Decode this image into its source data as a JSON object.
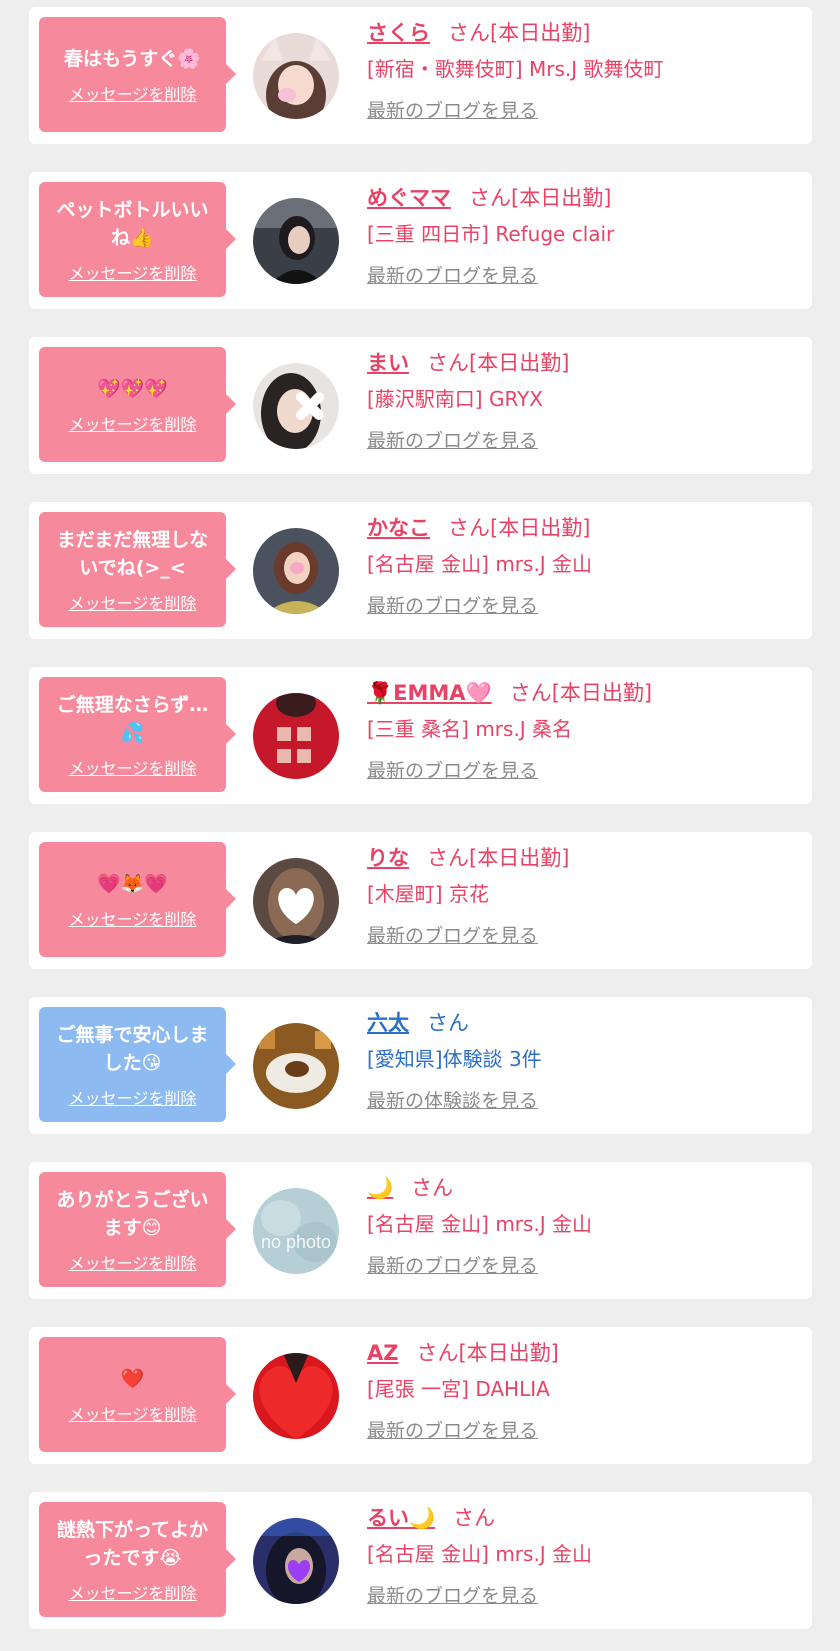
{
  "items": [
    {
      "message": "春はもうすぐ🌸",
      "delete_label": "メッセージを削除",
      "name": "さくら",
      "san": "さん",
      "status": "[本日出勤]",
      "shop": "[新宿・歌舞伎町] Mrs.J 歌舞伎町",
      "link": "最新のブログを見る",
      "type": "girl"
    },
    {
      "message": "ペットボトルいいね👍",
      "delete_label": "メッセージを削除",
      "name": "めぐママ",
      "san": "さん",
      "status": "[本日出勤]",
      "shop": "[三重 四日市] Refuge clair",
      "link": "最新のブログを見る",
      "type": "girl"
    },
    {
      "message": "💖💖💖",
      "delete_label": "メッセージを削除",
      "name": "まい",
      "san": "さん",
      "status": "[本日出勤]",
      "shop": "[藤沢駅南口] GRYX",
      "link": "最新のブログを見る",
      "type": "girl"
    },
    {
      "message": "まだまだ無理しないでね(>_<",
      "delete_label": "メッセージを削除",
      "name": "かなこ",
      "san": "さん",
      "status": "[本日出勤]",
      "shop": "[名古屋 金山] mrs.J 金山",
      "link": "最新のブログを見る",
      "type": "girl"
    },
    {
      "message": "ご無理なさらず…💦",
      "delete_label": "メッセージを削除",
      "name": "🌹EMMA🩷",
      "san": "さん",
      "status": "[本日出勤]",
      "shop": "[三重 桑名] mrs.J 桑名",
      "link": "最新のブログを見る",
      "type": "girl"
    },
    {
      "message": "💗🦊💗",
      "delete_label": "メッセージを削除",
      "name": "りな",
      "san": "さん",
      "status": "[本日出勤]",
      "shop": "[木屋町] 京花",
      "link": "最新のブログを見る",
      "type": "girl"
    },
    {
      "message": "ご無事で安心しました😘",
      "delete_label": "メッセージを削除",
      "name": "六太",
      "san": "さん",
      "status": "",
      "shop": "[愛知県]体験談 3件",
      "link": "最新の体験談を見る",
      "type": "user"
    },
    {
      "message": "ありがとうございます😊",
      "delete_label": "メッセージを削除",
      "name": "🌙",
      "san": "さん",
      "status": "",
      "shop": "[名古屋 金山] mrs.J 金山",
      "link": "最新のブログを見る",
      "type": "girl"
    },
    {
      "message": "❤️",
      "delete_label": "メッセージを削除",
      "name": "AZ",
      "san": "さん",
      "status": "[本日出勤]",
      "shop": "[尾張 一宮] DAHLIA",
      "link": "最新のブログを見る",
      "type": "girl"
    },
    {
      "message": "謎熱下がってよかったです😭",
      "delete_label": "メッセージを削除",
      "name": "るい🌙",
      "san": "さん",
      "status": "",
      "shop": "[名古屋 金山] mrs.J 金山",
      "link": "最新のブログを見る",
      "type": "girl"
    }
  ],
  "no_photo_text": "no photo",
  "colors": {
    "bubble_pink": "#f7899c",
    "bubble_blue": "#8ebaf2",
    "name_pink": "#e84366",
    "name_blue": "#2c6fc6",
    "link_gray": "#8b8b8b"
  },
  "avatar_icons": [
    "cat-ear-girl-photo",
    "dark-hair-girl-photo",
    "blurred-face-photo",
    "qipao-girl-photo",
    "red-shirt-photo",
    "heart-covered-face-photo",
    "cake-plate-photo",
    "no-photo-placeholder",
    "red-heart-photo",
    "purple-heart-selfie-photo"
  ]
}
